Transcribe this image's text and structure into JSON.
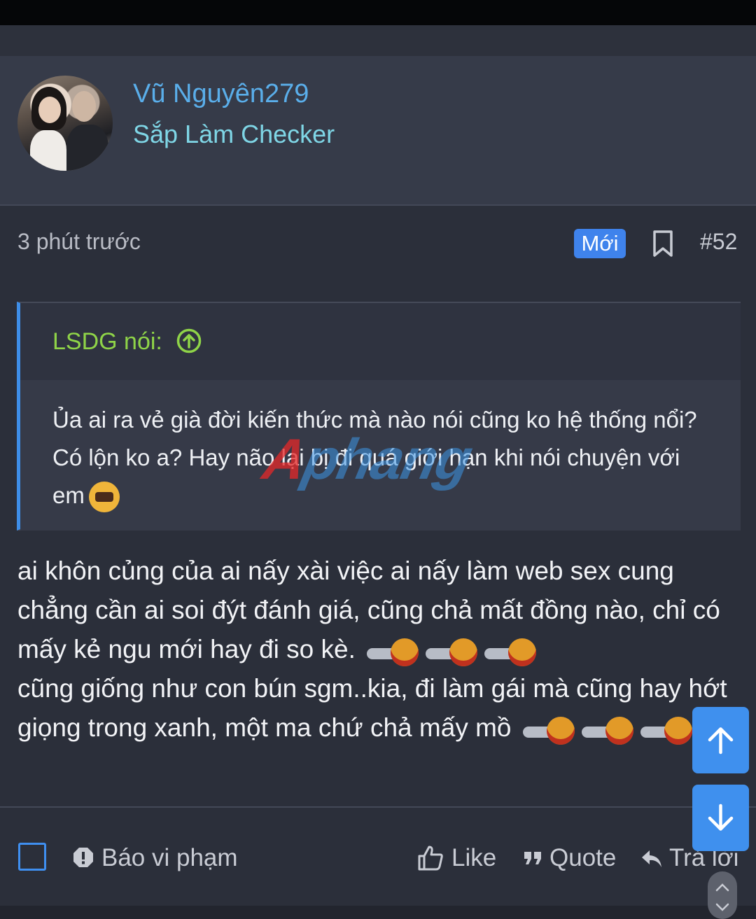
{
  "post": {
    "author": "Vũ Nguyên279",
    "user_title": "Sắp Làm Checker",
    "time": "3 phút trước",
    "badge": "Mới",
    "post_number": "#52",
    "quote": {
      "author_label": "LSDG nói:",
      "text": "Ủa ai ra vẻ già đời kiến thức mà nào nói cũng ko hệ thống nổi? Có lộn ko a? Hay não lại bị đi quá giới hạn khi nói chuyện với em"
    },
    "body_lines": [
      "ai khôn củng của ai nấy xài việc ai nấy làm web sex cung chẳng cần ai soi đýt đánh giá, cũng chả mất đồng nào, chỉ có mấy kẻ ngu mới hay đi so kè.",
      "cũng giống như con bún sgm..kia, đi làm gái mà cũng hay hớt giọng trong xanh, một ma chứ chả mấy mồ"
    ]
  },
  "watermark": {
    "first": "A",
    "rest": "phang"
  },
  "actions": {
    "report": "Báo vi phạm",
    "like": "Like",
    "quote": "Quote",
    "reply": "Trả lời"
  },
  "icons": [
    "avatar",
    "bookmark-icon",
    "arrow-up-circle-icon",
    "sleep-emoji-icon",
    "laugh-emoji-icon",
    "checkbox-icon",
    "alert-icon",
    "thumbs-up-icon",
    "quote-icon",
    "reply-icon",
    "arrow-up-icon",
    "arrow-down-icon",
    "chevron-up-icon",
    "chevron-down-icon"
  ],
  "colors": {
    "accent": "#3f83ec",
    "username": "#5aaeea",
    "user_title": "#7fd6e6",
    "quote_author": "#8fd448",
    "background": "#2b2f3a"
  }
}
